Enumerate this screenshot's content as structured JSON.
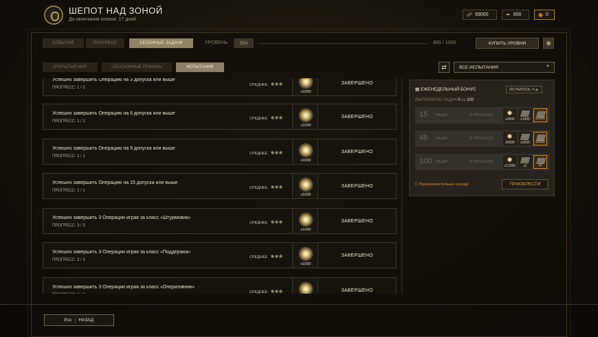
{
  "header": {
    "title": "ШЕПОТ НАД ЗОНОЙ",
    "subtitle": "До окончания сезона: 17 дней",
    "currencies": [
      {
        "icon": "link-icon",
        "value": "59000"
      },
      {
        "icon": "feather-icon",
        "value": "800"
      },
      {
        "icon": "coin-icon",
        "value": "0"
      }
    ]
  },
  "topbar": {
    "tabs": [
      "СОБЫТИЕ",
      "ПРОГРЕСС",
      "СЕЗОННЫЕ ЗАДАЧИ"
    ],
    "active_tab": "СЕЗОННЫЕ ЗАДАЧИ",
    "level_label": "УРОВЕНЬ",
    "level_value": "584",
    "level_progress_text": "800 / 1000",
    "level_progress_fraction": 0.8,
    "buy_levels_label": "КУПИТЬ УРОВНИ"
  },
  "subtabs": {
    "tabs": [
      "ОТКРЫТЫЙ МИР",
      "СЕССИОННЫЕ РЕЖИМЫ",
      "ИСПЫТАНИЯ"
    ],
    "active_tab": "ИСПЫТАНИЯ"
  },
  "filter": {
    "selected": "ВСЕ ИСПЫТАНИЯ"
  },
  "tasks": [
    {
      "name": "Успешно завершить Операцию на 3 допуска или выше",
      "progress": "ПРОГРЕСС: 1 / 1",
      "difficulty": "СРЕДНЕЕ",
      "reward": "x1000",
      "status": "ЗАВЕРШЕНО"
    },
    {
      "name": "Успешно завершить Операцию на 6 допуска или выше",
      "progress": "ПРОГРЕСС: 1 / 1",
      "difficulty": "СРЕДНЕЕ",
      "reward": "x1000",
      "status": "ЗАВЕРШЕНО"
    },
    {
      "name": "Успешно завершить Операцию на 9 допуска или выше",
      "progress": "ПРОГРЕСС: 1 / 1",
      "difficulty": "СРЕДНЕЕ",
      "reward": "x1000",
      "status": "ЗАВЕРШЕНО"
    },
    {
      "name": "Успешно завершить Операцию на 15 допуска или выше",
      "progress": "ПРОГРЕСС: 1 / 1",
      "difficulty": "СРЕДНЕЕ",
      "reward": "x1000",
      "status": "ЗАВЕРШЕНО"
    },
    {
      "name": "Успешно завершить 3 Операции играя за класс «Штурмовик»",
      "progress": "ПРОГРЕСС: 3 / 3",
      "difficulty": "СРЕДНЕЕ",
      "reward": "x1000",
      "status": "ЗАВЕРШЕНО"
    },
    {
      "name": "Успешно завершить 3 Операции играя за класс «Поддержка»",
      "progress": "ПРОГРЕСС: 3 / 3",
      "difficulty": "СРЕДНЕЕ",
      "reward": "x1000",
      "status": "ЗАВЕРШЕНО"
    },
    {
      "name": "Успешно завершить 3 Операции играя за класс «Оперативник»",
      "progress": "ПРОГРЕСС: 3 / 3",
      "difficulty": "СРЕДНЕЕ",
      "reward": "x1000",
      "status": "ЗАВЕРШЕНО"
    }
  ],
  "weekly": {
    "title": "ЕЖЕНЕДЕЛЬНЫЙ БОНУС",
    "time_left": "ОСТАЛОСЬ: 0 д.",
    "done_prefix": "ВЫПОЛНЕНО ЗАДАЧ",
    "done_value": "0",
    "done_of": "из",
    "done_total": "100",
    "tiers": [
      {
        "number": "15",
        "label": "ЗАДАЧ",
        "status": "В ПРОЦЕССЕ",
        "rewards": [
          "x3000",
          "x1000",
          "x1000"
        ]
      },
      {
        "number": "45",
        "label": "ЗАДАЧ",
        "status": "В ПРОЦЕССЕ",
        "rewards": [
          "x5000",
          "x2000",
          "x2000"
        ]
      },
      {
        "number": "100",
        "label": "ЗАДАЧ",
        "status": "В ПРОЦЕССЕ",
        "rewards": [
          "x12000",
          "x2",
          "x2"
        ]
      }
    ],
    "promo": "С Премиумом больше наград!",
    "buy_label": "ПРИОБРЕСТИ"
  },
  "footer": {
    "key": "Esc",
    "back_label": "НАЗАД"
  }
}
